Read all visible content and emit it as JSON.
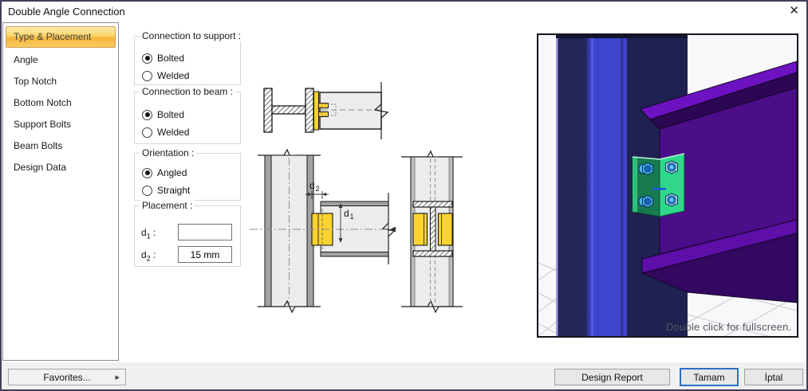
{
  "window": {
    "title": "Double Angle Connection",
    "close_glyph": "✕"
  },
  "sidebar": {
    "items": [
      {
        "label": "Type & Placement",
        "selected": true
      },
      {
        "label": "Angle",
        "selected": false
      },
      {
        "label": "Top Notch",
        "selected": false
      },
      {
        "label": "Bottom Notch",
        "selected": false
      },
      {
        "label": "Support Bolts",
        "selected": false
      },
      {
        "label": "Beam Bolts",
        "selected": false
      },
      {
        "label": "Design Data",
        "selected": false
      }
    ]
  },
  "groups": {
    "support": {
      "title": "Connection to support :",
      "options": [
        {
          "label": "Bolted",
          "selected": true
        },
        {
          "label": "Welded",
          "selected": false
        }
      ]
    },
    "beam": {
      "title": "Connection to beam :",
      "options": [
        {
          "label": "Bolted",
          "selected": true
        },
        {
          "label": "Welded",
          "selected": false
        }
      ]
    },
    "orientation": {
      "title": "Orientation :",
      "options": [
        {
          "label": "Angled",
          "selected": true
        },
        {
          "label": "Straight",
          "selected": false
        }
      ]
    },
    "placement": {
      "title": "Placement :",
      "fields": [
        {
          "base": "d",
          "sub": "1",
          "colon": ":",
          "value": ""
        },
        {
          "base": "d",
          "sub": "2",
          "colon": ":",
          "value": "15 mm"
        }
      ]
    }
  },
  "drawing": {
    "d1": {
      "base": "d",
      "sub": "1"
    },
    "d2": {
      "base": "d",
      "sub": "2"
    }
  },
  "viewport": {
    "hint": "Double click for fullscreen."
  },
  "footer": {
    "favorites": "Favorites...",
    "favorites_arrow": "▸",
    "design_report": "Design Report",
    "ok": "Tamam",
    "cancel": "İptal"
  },
  "colors": {
    "selected_item_orange": "#f6b63e",
    "angle_yellow": "#fbd32e",
    "column_blue_bright": "#3e44cb",
    "column_blue_dark": "#232458",
    "beam_purple": "#4b0d88",
    "angle_green_bright": "#2fd78b",
    "angle_green_dark": "#187a4f",
    "bolt_blue": "#2a7fd4",
    "ok_border_blue": "#2a70c8"
  }
}
